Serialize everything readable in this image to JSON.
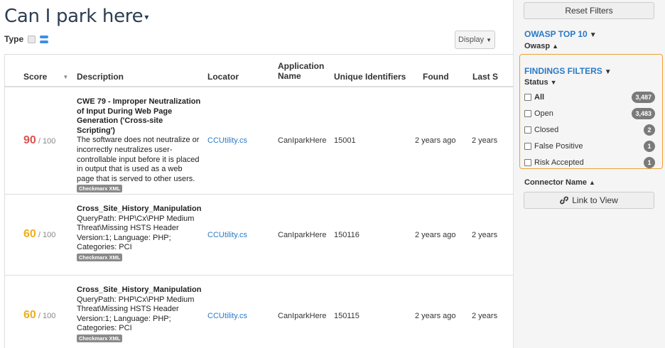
{
  "page": {
    "title": "Can I park here",
    "type_label": "Type",
    "display_label": "Display"
  },
  "table": {
    "headers": {
      "score": "Score",
      "description": "Description",
      "locator": "Locator",
      "app_name_line1": "Application",
      "app_name_line2": "Name",
      "uid": "Unique Identifiers",
      "found": "Found",
      "last": "Last S"
    },
    "score_suffix": "/ 100",
    "rows": [
      {
        "score": "90",
        "title": "CWE 79 - Improper Neutralization of Input During Web Page Generation ('Cross-site Scripting')",
        "body": "The software does not neutralize or incorrectly neutralizes user-controllable input before it is placed in output that is used as a web page that is served to other users.",
        "tag": "Checkmarx XML",
        "locator": "CCUtility.cs",
        "app": "CanIparkHere",
        "uid": "15001",
        "found": "2 years ago",
        "last": "2 years"
      },
      {
        "score": "60",
        "title": "Cross_Site_History_Manipulation",
        "body": "QueryPath: PHP\\Cx\\PHP Medium Threat\\Missing HSTS Header Version:1; Language: PHP; Categories: PCI",
        "tag": "Checkmarx XML",
        "locator": "CCUtility.cs",
        "app": "CanIparkHere",
        "uid": "150116",
        "found": "2 years ago",
        "last": "2 years"
      },
      {
        "score": "60",
        "title": "Cross_Site_History_Manipulation",
        "body": "QueryPath: PHP\\Cx\\PHP Medium Threat\\Missing HSTS Header Version:1; Language: PHP; Categories: PCI",
        "tag": "Checkmarx XML",
        "locator": "CCUtility.cs",
        "app": "CanIparkHere",
        "uid": "150115",
        "found": "2 years ago",
        "last": "2 years"
      }
    ]
  },
  "sidebar": {
    "reset_label": "Reset Filters",
    "owasp_title": "OWASP TOP 10",
    "owasp_sub": "Owasp",
    "findings_title": "FINDINGS FILTERS",
    "status_label": "Status",
    "statuses": [
      {
        "label": "All",
        "count": "3,487"
      },
      {
        "label": "Open",
        "count": "3,483"
      },
      {
        "label": "Closed",
        "count": "2"
      },
      {
        "label": "False Positive",
        "count": "1"
      },
      {
        "label": "Risk Accepted",
        "count": "1"
      }
    ],
    "connector_label": "Connector Name",
    "link_label": "Link to View"
  },
  "colors": {
    "accent": "#2a7ac7",
    "score_high": "#d9534f",
    "score_medium": "#f0ad1e",
    "highlight": "#f0a030"
  },
  "icons": {
    "down_caret": "caret-down-icon",
    "up_caret": "caret-up-icon",
    "link": "link-icon"
  }
}
